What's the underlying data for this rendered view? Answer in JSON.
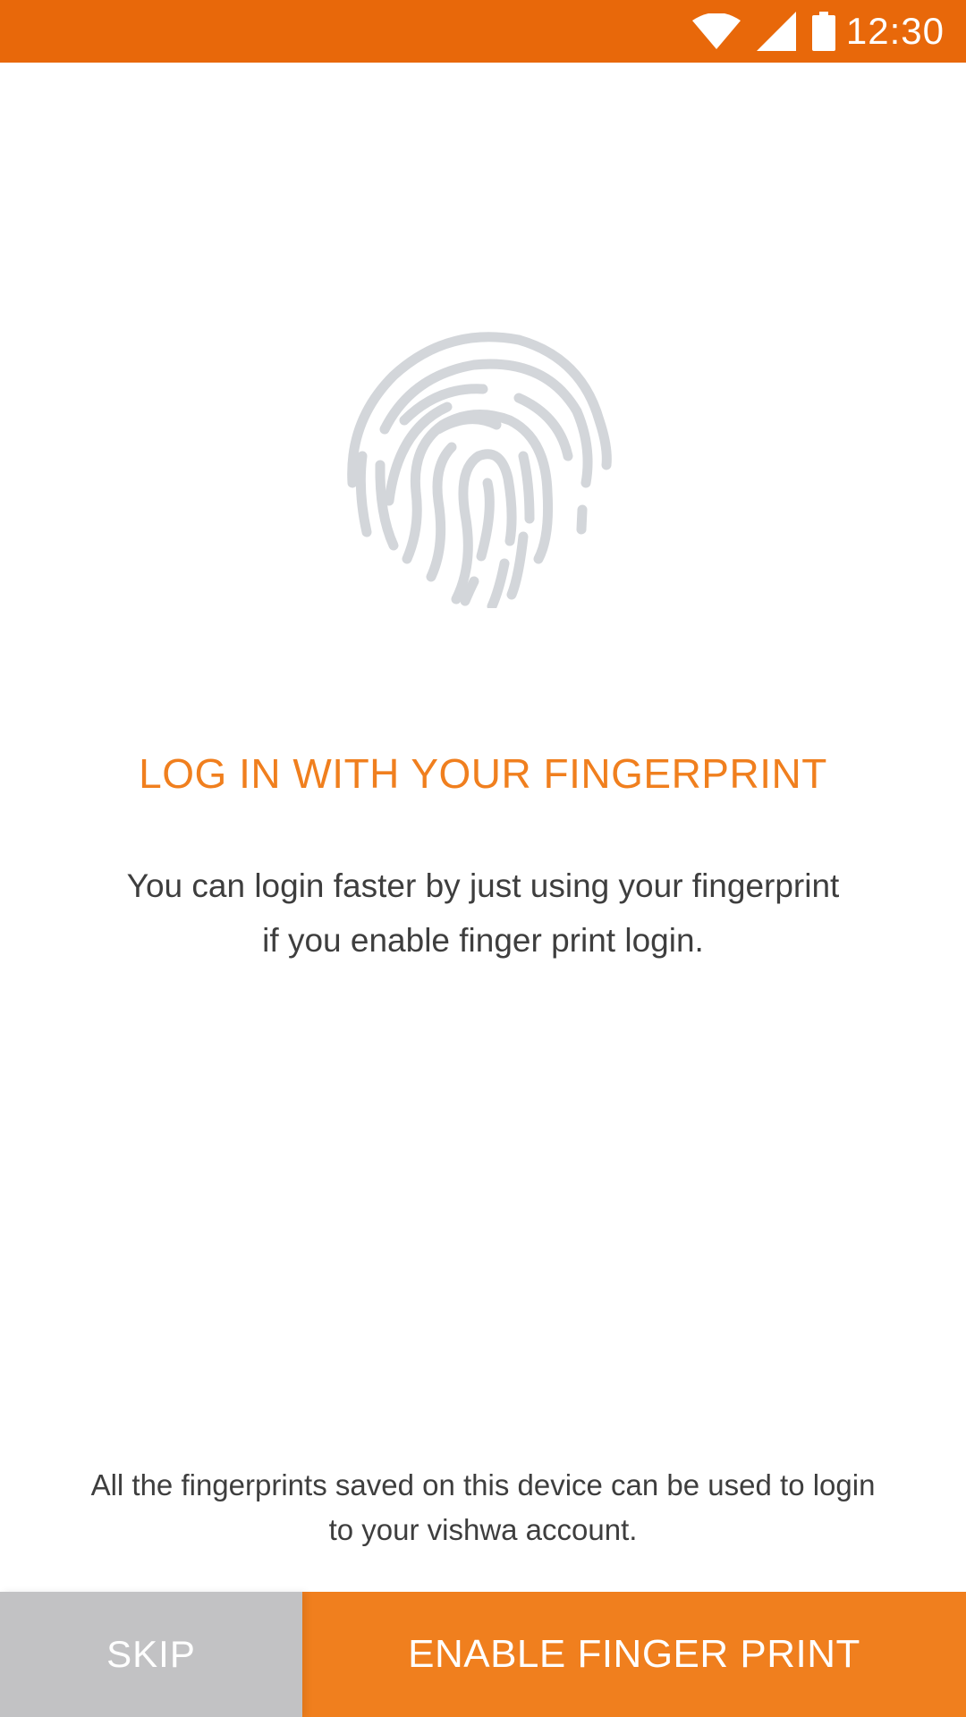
{
  "status_bar": {
    "time": "12:30",
    "icons": [
      "wifi-icon",
      "signal-icon",
      "battery-icon"
    ],
    "background_color": "#E8680A"
  },
  "main": {
    "fingerprint_icon": "fingerprint-icon",
    "title": "LOG IN WITH YOUR FINGERPRINT",
    "description_line1": "You can login faster by just using your fingerprint",
    "description_line2": "if you enable finger print login.",
    "footer_line1": "All the fingerprints saved on this device can be used to login",
    "footer_line2": "to your vishwa account.",
    "accent_color": "#F07F1E"
  },
  "actions": {
    "skip_label": "SKIP",
    "enable_label": "ENABLE FINGER PRINT"
  }
}
